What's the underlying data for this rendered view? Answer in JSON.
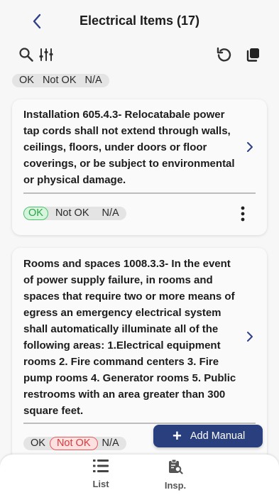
{
  "header": {
    "title": "Electrical Items (17)"
  },
  "icons": {
    "back": "chevron-left-icon",
    "search": "search-icon",
    "filter": "sliders-icon",
    "refresh": "refresh-icon",
    "copy": "copy-icon"
  },
  "filter": {
    "options": [
      "OK",
      "Not OK",
      "N/A"
    ]
  },
  "items": [
    {
      "text": "Installation 605.4.3- Relocatabale power tap cords shall not extend  through walls, ceilings, floors, under doors or floor coverings, or be subject to environmental or physical damage.",
      "status": {
        "options": [
          "OK",
          "Not OK",
          "N/A"
        ],
        "selected": "OK"
      }
    },
    {
      "text": "Rooms and spaces 1008.3.3- In the event of power supply failure, in rooms and spaces that require two or more means of egress an emergency electrical system shall automatically illuminate all of the following areas: 1.Electrical equipment rooms 2. Fire command centers 3. Fire pump rooms 4. Generator rooms 5. Public restrooms with an area greater than 300 square feet.",
      "status": {
        "options": [
          "OK",
          "Not OK",
          "N/A"
        ],
        "selected": "Not OK"
      }
    }
  ],
  "fab": {
    "label": "Add Manual"
  },
  "nav": {
    "items": [
      {
        "label": "List"
      },
      {
        "label": "Insp."
      }
    ]
  },
  "colors": {
    "accent": "#2a3f7e",
    "ok": "#2da34c",
    "not_ok": "#d93b3b",
    "back": "#2f3f8a"
  }
}
